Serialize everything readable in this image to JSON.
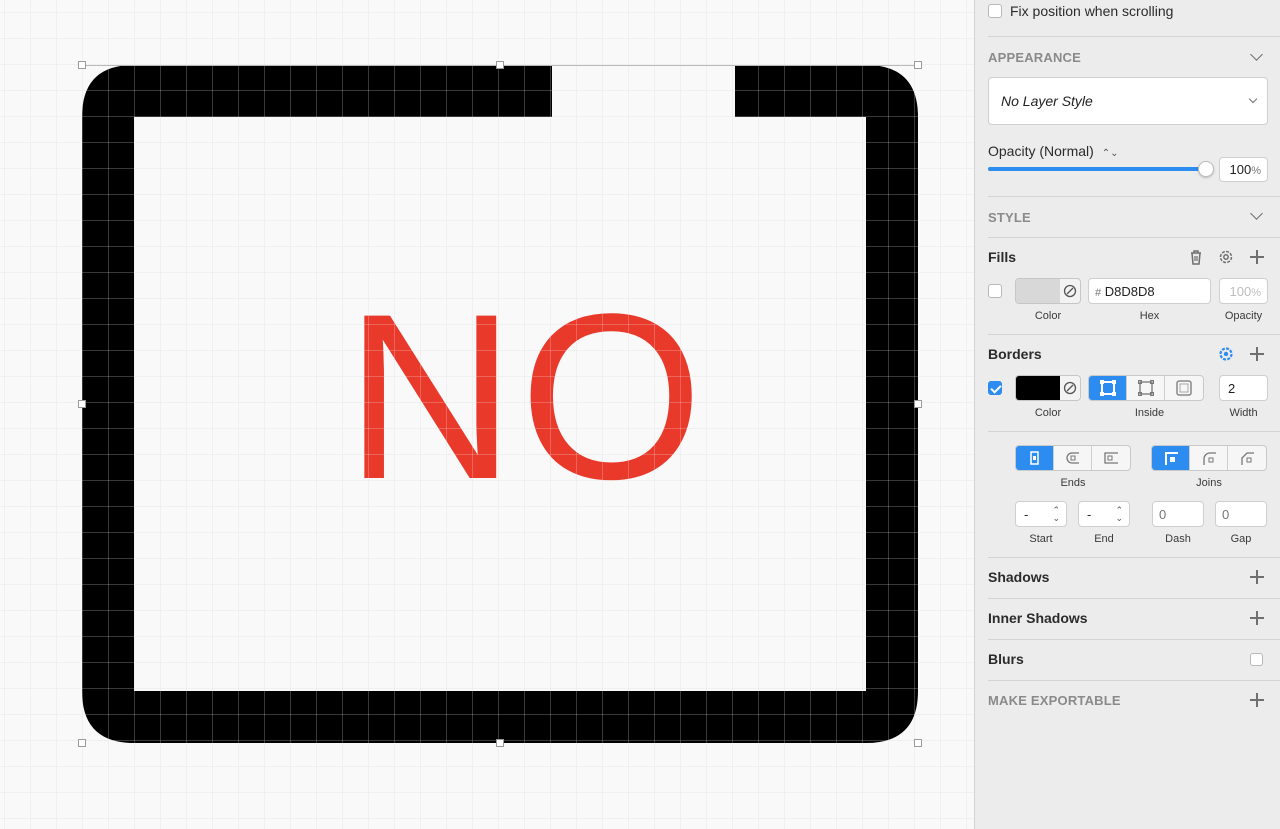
{
  "canvas": {
    "label": "NO",
    "label_color": "#e8392b",
    "border_color": "#000000"
  },
  "inspector": {
    "fix_position": {
      "label": "Fix position when scrolling",
      "checked": false
    },
    "appearance": {
      "title": "APPEARANCE",
      "layer_style": "No Layer Style",
      "opacity_label": "Opacity (Normal)",
      "opacity_value": "100",
      "opacity_unit": "%",
      "opacity_fraction": 1.0
    },
    "style": {
      "title": "STYLE"
    },
    "fills": {
      "title": "Fills",
      "enabled": false,
      "hex_prefix": "#",
      "hex": "D8D8D8",
      "swatch": "#d8d8d8",
      "opacity_value": "100",
      "opacity_unit": "%",
      "labels": {
        "color": "Color",
        "hex": "Hex",
        "opacity": "Opacity"
      }
    },
    "borders": {
      "title": "Borders",
      "enabled": true,
      "swatch": "#000000",
      "width": "2",
      "labels": {
        "color": "Color",
        "position": "Inside",
        "width": "Width"
      }
    },
    "stroke_options": {
      "ends_label": "Ends",
      "joins_label": "Joins",
      "start_value": "-",
      "end_value": "-",
      "dash_placeholder": "0",
      "gap_placeholder": "0",
      "labels": {
        "start": "Start",
        "end": "End",
        "dash": "Dash",
        "gap": "Gap"
      }
    },
    "shadows": {
      "title": "Shadows"
    },
    "inner_shadows": {
      "title": "Inner Shadows"
    },
    "blurs": {
      "title": "Blurs",
      "checked": false
    },
    "export": {
      "title": "MAKE EXPORTABLE"
    },
    "accent_color": "#2d8cf0"
  }
}
